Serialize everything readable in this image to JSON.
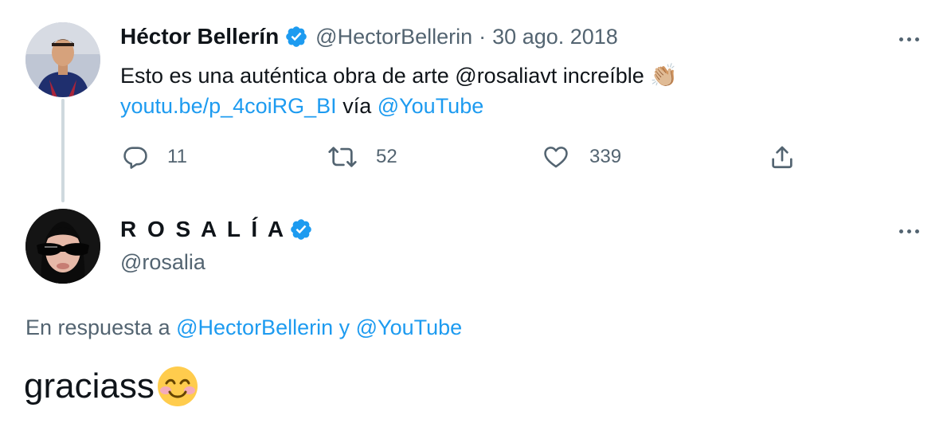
{
  "tweet1": {
    "author_name": "Héctor Bellerín",
    "handle": "@HectorBellerin",
    "separator": "·",
    "date": "30 ago. 2018",
    "text_before": "Esto es una auténtica obra de arte ",
    "mention": "@rosaliavt",
    "text_after": " increíble ",
    "emoji": "👏🏼",
    "link": "youtu.be/p_4coiRG_BI",
    "via": " vía ",
    "via_mention": "@YouTube",
    "replies": "11",
    "retweets": "52",
    "likes": "339"
  },
  "tweet2": {
    "author_name": "R O S A L Í A",
    "handle": "@rosalia",
    "reply_prefix": "En respuesta a ",
    "reply_to_1": "@HectorBellerin",
    "reply_joiner": " y ",
    "reply_to_2": "@YouTube",
    "text": "graciass",
    "emoji": "😊"
  },
  "icons": {
    "verified": "verified-badge-icon",
    "more": "more-options-icon",
    "reply": "reply-icon",
    "retweet": "retweet-icon",
    "like": "like-icon",
    "share": "share-icon"
  },
  "colors": {
    "text": "#0f1419",
    "muted": "#536471",
    "link": "#1d9bf0",
    "verified": "#1d9bf0",
    "thread_line": "#cfd9de"
  }
}
